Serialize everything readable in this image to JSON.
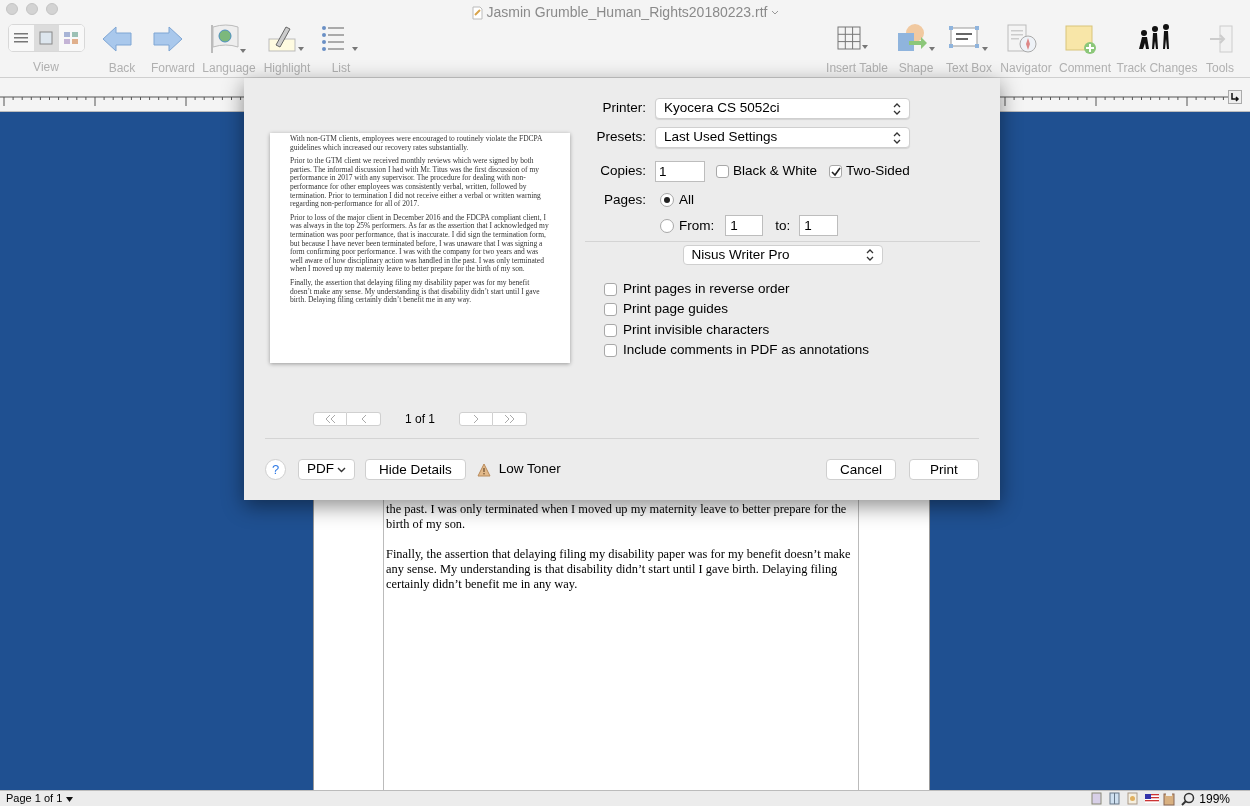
{
  "window": {
    "title": "Jasmin Grumble_Human_Rights20180223.rtf"
  },
  "toolbar": {
    "view": {
      "label": "View",
      "segments": [
        {
          "kind": "list",
          "selected": false
        },
        {
          "kind": "page",
          "selected": true
        },
        {
          "kind": "grid",
          "selected": false
        }
      ]
    },
    "left_items": [
      {
        "kind": "back",
        "label": "Back"
      },
      {
        "kind": "forward",
        "label": "Forward"
      },
      {
        "kind": "globe",
        "label": "Language"
      },
      {
        "kind": "highlight",
        "label": "Highlight"
      },
      {
        "kind": "list",
        "label": "List"
      }
    ],
    "right_items": [
      {
        "kind": "table",
        "label": "Insert Table"
      },
      {
        "kind": "shape",
        "label": "Shape"
      },
      {
        "kind": "textbox",
        "label": "Text Box"
      },
      {
        "kind": "navigator",
        "label": "Navigator"
      },
      {
        "kind": "comment",
        "label": "Comment"
      },
      {
        "kind": "track",
        "label": "Track Changes"
      },
      {
        "kind": "tools",
        "label": "Tools"
      }
    ]
  },
  "document": {
    "paragraphs": [
      "the past. I was only terminated when I moved up my maternity leave to better prepare for the birth of my son.",
      "Finally, the assertion that delaying filing my disability paper was for my benefit doesn’t make any sense. My understanding is that disability didn’t start until I gave birth. Delaying filing certainly didn’t benefit me in any way."
    ]
  },
  "print_dialog": {
    "preview": {
      "paragraphs": [
        "With non-GTM clients, employees were encouraged to routinely violate the FDCPA guidelines which increased our recovery rates substantially.",
        "Prior to the GTM client we received monthly reviews which were signed by both parties. The informal discussion I had with Mr. Titus was the first discussion of my performance in 2017 with any supervisor. The procedure for dealing with non-performance for other employees was consistently verbal, written, followed by termination. Prior to termination I did not receive either a verbal or written warning regarding non-performance for all of 2017.",
        "Prior to loss of the major client in December 2016 and the FDCPA compliant client, I was always in the top 25% performers. As far as the assertion that I acknowledged my termination was poor performance, that is inaccurate. I did sign the termination form, but because I have never been terminated before, I was unaware that I was signing a form confirming poor performance. I was with the company for two years and was well aware of how disciplinary action was handled in the past. I was only terminated when I moved up my maternity leave to better prepare for the birth of my son.",
        "Finally, the assertion that delaying filing my disability paper was for my benefit doesn’t make any sense. My understanding is that disability didn’t start until I gave birth. Delaying filing certainly didn’t benefit me in any way."
      ],
      "page_counter": "1 of 1"
    },
    "printer": {
      "label": "Printer:",
      "value": "Kyocera CS 5052ci"
    },
    "presets": {
      "label": "Presets:",
      "value": "Last Used Settings"
    },
    "copies": {
      "label": "Copies:",
      "value": "1"
    },
    "black_white": {
      "label": "Black & White",
      "checked": false
    },
    "two_sided": {
      "label": "Two-Sided",
      "checked": true
    },
    "pages": {
      "label": "Pages:",
      "options": [
        {
          "label": "All",
          "selected": true
        },
        {
          "label": "From:",
          "selected": false
        }
      ],
      "from_value": "1",
      "to_label": "to:",
      "to_value": "1"
    },
    "section_menu": {
      "value": "Nisus Writer Pro"
    },
    "options": [
      {
        "label": "Print pages in reverse order",
        "checked": false
      },
      {
        "label": "Print page guides",
        "checked": false
      },
      {
        "label": "Print invisible characters",
        "checked": false
      },
      {
        "label": "Include comments in PDF as annotations",
        "checked": false
      }
    ],
    "help": "?",
    "pdf": "PDF",
    "hide_details": "Hide Details",
    "warning": "Low Toner",
    "cancel": "Cancel",
    "print": "Print"
  },
  "status_bar": {
    "page": "Page 1 of 1",
    "zoom": "199%"
  }
}
